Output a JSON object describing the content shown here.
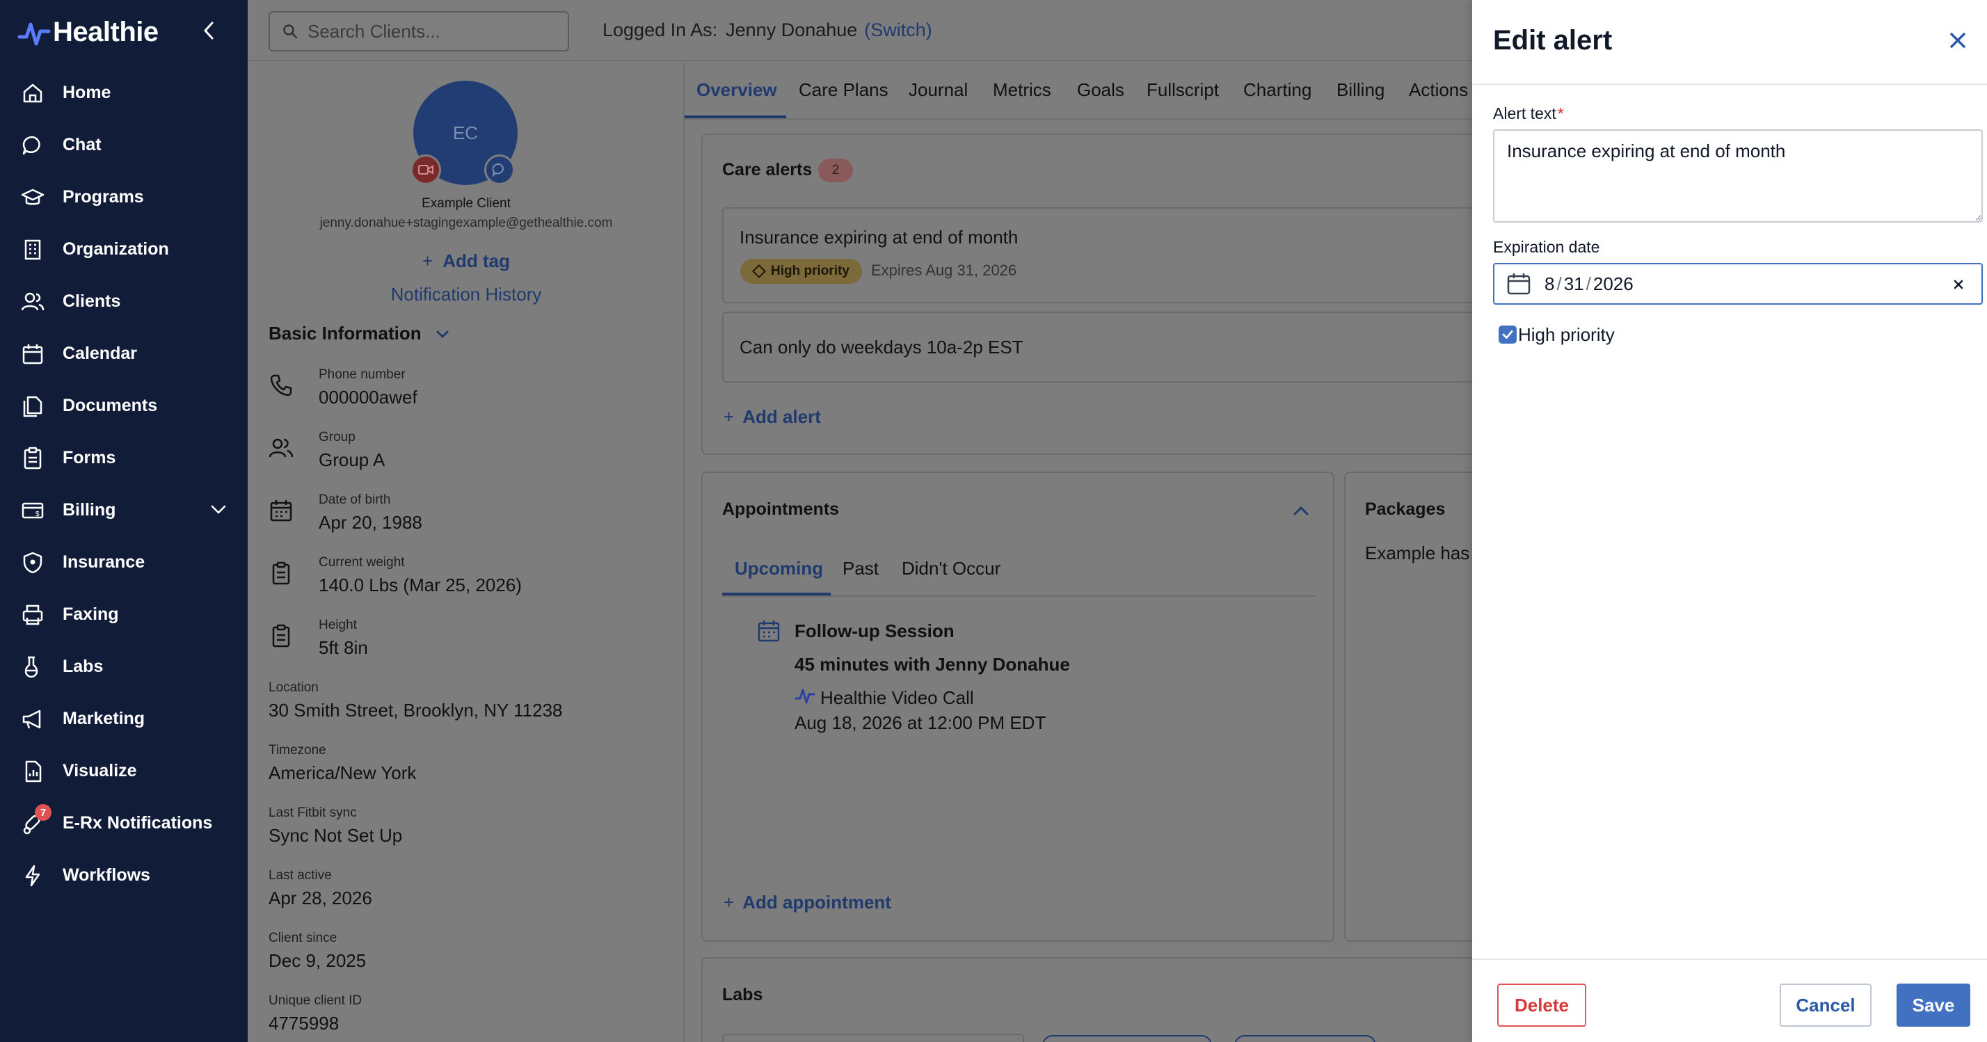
{
  "app": {
    "name": "Healthie",
    "accent": "#4171c0",
    "sidebar_bg": "#111d38"
  },
  "sidebar": {
    "items": [
      {
        "label": "Home",
        "icon": "home-icon"
      },
      {
        "label": "Chat",
        "icon": "chat-icon"
      },
      {
        "label": "Programs",
        "icon": "programs-icon"
      },
      {
        "label": "Organization",
        "icon": "organization-icon"
      },
      {
        "label": "Clients",
        "icon": "clients-icon"
      },
      {
        "label": "Calendar",
        "icon": "calendar-icon"
      },
      {
        "label": "Documents",
        "icon": "documents-icon"
      },
      {
        "label": "Forms",
        "icon": "forms-icon"
      },
      {
        "label": "Billing",
        "icon": "billing-icon"
      },
      {
        "label": "Insurance",
        "icon": "insurance-icon"
      },
      {
        "label": "Faxing",
        "icon": "fax-icon"
      },
      {
        "label": "Labs",
        "icon": "labs-icon"
      },
      {
        "label": "Marketing",
        "icon": "megaphone-icon"
      },
      {
        "label": "Visualize",
        "icon": "visualize-icon"
      },
      {
        "label": "E-Rx Notifications",
        "icon": "erx-icon",
        "badge": "7"
      },
      {
        "label": "Workflows",
        "icon": "workflows-icon"
      }
    ]
  },
  "header": {
    "search_placeholder": "Search Clients...",
    "logged_in_label": "Logged In As:",
    "user_name": "Jenny Donahue",
    "switch_label": "(Switch)"
  },
  "client": {
    "initials": "EC",
    "name": "Example Client",
    "email": "jenny.donahue+stagingexample@gethealthie.com",
    "add_tag": "Add tag",
    "notification_history": "Notification History",
    "basic_info_title": "Basic Information",
    "fields": [
      {
        "key": "Phone number",
        "value": "000000awef"
      },
      {
        "key": "Group",
        "value": "Group A"
      },
      {
        "key": "Date of birth",
        "value": "Apr 20, 1988"
      },
      {
        "key": "Current weight",
        "value": "140.0 Lbs (Mar 25, 2026)"
      },
      {
        "key": "Height",
        "value": "5ft 8in"
      },
      {
        "key": "Location",
        "value": "30 Smith Street, Brooklyn, NY 11238"
      },
      {
        "key": "Timezone",
        "value": "America/New York"
      },
      {
        "key": "Last Fitbit sync",
        "value": "Sync Not Set Up"
      },
      {
        "key": "Last active",
        "value": "Apr 28, 2026"
      },
      {
        "key": "Client since",
        "value": "Dec 9, 2025"
      },
      {
        "key": "Unique client ID",
        "value": "4775998"
      }
    ]
  },
  "tabs": [
    "Overview",
    "Care Plans",
    "Journal",
    "Metrics",
    "Goals",
    "Fullscript",
    "Charting",
    "Billing",
    "Actions"
  ],
  "care_alerts": {
    "title": "Care alerts",
    "count": "2",
    "items": [
      {
        "text": "Insurance expiring at end of month",
        "priority": "High priority",
        "expires": "Expires Aug 31, 2026"
      },
      {
        "text": "Can only do weekdays 10a-2p EST"
      }
    ],
    "add_label": "Add alert"
  },
  "appointments": {
    "title": "Appointments",
    "subtabs": [
      "Upcoming",
      "Past",
      "Didn't Occur"
    ],
    "item": {
      "title": "Follow-up Session",
      "duration": "45 minutes with Jenny Donahue",
      "location": "Healthie Video Call",
      "when": "Aug 18, 2026 at 12:00 PM EDT"
    },
    "add_label": "Add appointment"
  },
  "packages": {
    "title": "Packages",
    "text": "Example has r"
  },
  "labs": {
    "title": "Labs"
  },
  "drawer": {
    "title": "Edit alert",
    "alert_text_label": "Alert text",
    "required_mark": "*",
    "alert_text_value": "Insurance expiring at end of month",
    "expiration_label": "Expiration date",
    "date_month": "8",
    "date_day": "31",
    "date_year": "2026",
    "date_sep": "/",
    "high_priority_label": "High priority",
    "high_priority_checked": true,
    "delete_label": "Delete",
    "cancel_label": "Cancel",
    "save_label": "Save"
  }
}
